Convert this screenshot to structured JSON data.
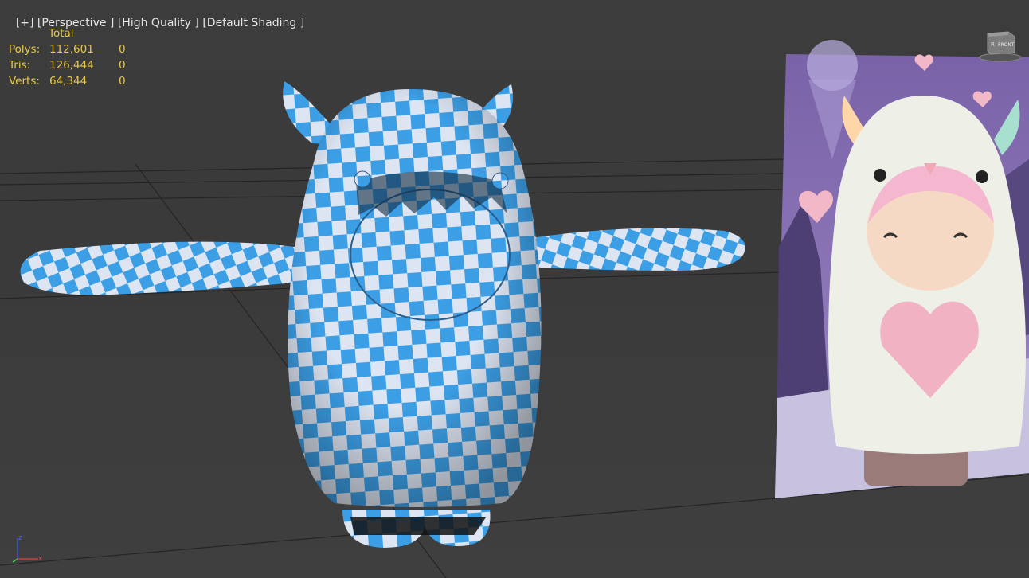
{
  "viewport": {
    "label_parts": [
      "[+]",
      "[Perspective ]",
      "[High Quality ]",
      "[Default Shading ]"
    ],
    "stats": {
      "header": "Total",
      "rows": [
        {
          "label": "Polys:",
          "total": "112,601",
          "selected": "0"
        },
        {
          "label": "Tris:",
          "total": "126,444",
          "selected": "0"
        },
        {
          "label": "Verts:",
          "total": "64,344",
          "selected": "0"
        }
      ]
    },
    "viewcube": {
      "face_label": "FRONT",
      "side_label": "R"
    },
    "axis_tripod": {
      "x": "x",
      "z": "z"
    }
  },
  "colors": {
    "background": "#3a3a3a",
    "grid_line": "#232323",
    "checker_blue": "#3c9fe6",
    "checker_white": "#dde5f2",
    "stats_text": "#e6c84a",
    "label_text": "#e6e6e6"
  }
}
